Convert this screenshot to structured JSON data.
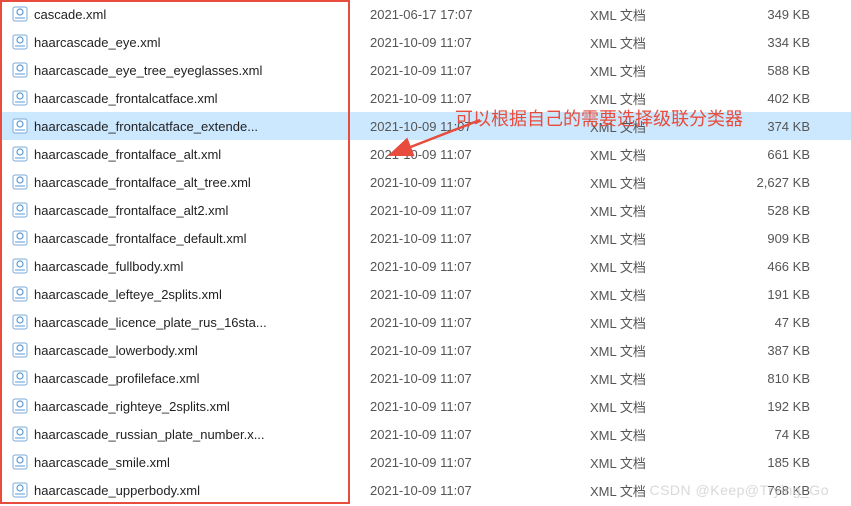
{
  "annotation": "可以根据自己的需要选择级联分类器",
  "watermark": "CSDN @Keep@Trying_Go",
  "files": [
    {
      "name": "cascade.xml",
      "date": "2021-06-17 17:07",
      "type": "XML 文档",
      "size": "349 KB",
      "selected": false
    },
    {
      "name": "haarcascade_eye.xml",
      "date": "2021-10-09 11:07",
      "type": "XML 文档",
      "size": "334 KB",
      "selected": false
    },
    {
      "name": "haarcascade_eye_tree_eyeglasses.xml",
      "date": "2021-10-09 11:07",
      "type": "XML 文档",
      "size": "588 KB",
      "selected": false
    },
    {
      "name": "haarcascade_frontalcatface.xml",
      "date": "2021-10-09 11:07",
      "type": "XML 文档",
      "size": "402 KB",
      "selected": false
    },
    {
      "name": "haarcascade_frontalcatface_extende...",
      "date": "2021-10-09 11:07",
      "type": "XML 文档",
      "size": "374 KB",
      "selected": true
    },
    {
      "name": "haarcascade_frontalface_alt.xml",
      "date": "2021-10-09 11:07",
      "type": "XML 文档",
      "size": "661 KB",
      "selected": false
    },
    {
      "name": "haarcascade_frontalface_alt_tree.xml",
      "date": "2021-10-09 11:07",
      "type": "XML 文档",
      "size": "2,627 KB",
      "selected": false
    },
    {
      "name": "haarcascade_frontalface_alt2.xml",
      "date": "2021-10-09 11:07",
      "type": "XML 文档",
      "size": "528 KB",
      "selected": false
    },
    {
      "name": "haarcascade_frontalface_default.xml",
      "date": "2021-10-09 11:07",
      "type": "XML 文档",
      "size": "909 KB",
      "selected": false
    },
    {
      "name": "haarcascade_fullbody.xml",
      "date": "2021-10-09 11:07",
      "type": "XML 文档",
      "size": "466 KB",
      "selected": false
    },
    {
      "name": "haarcascade_lefteye_2splits.xml",
      "date": "2021-10-09 11:07",
      "type": "XML 文档",
      "size": "191 KB",
      "selected": false
    },
    {
      "name": "haarcascade_licence_plate_rus_16sta...",
      "date": "2021-10-09 11:07",
      "type": "XML 文档",
      "size": "47 KB",
      "selected": false
    },
    {
      "name": "haarcascade_lowerbody.xml",
      "date": "2021-10-09 11:07",
      "type": "XML 文档",
      "size": "387 KB",
      "selected": false
    },
    {
      "name": "haarcascade_profileface.xml",
      "date": "2021-10-09 11:07",
      "type": "XML 文档",
      "size": "810 KB",
      "selected": false
    },
    {
      "name": "haarcascade_righteye_2splits.xml",
      "date": "2021-10-09 11:07",
      "type": "XML 文档",
      "size": "192 KB",
      "selected": false
    },
    {
      "name": "haarcascade_russian_plate_number.x...",
      "date": "2021-10-09 11:07",
      "type": "XML 文档",
      "size": "74 KB",
      "selected": false
    },
    {
      "name": "haarcascade_smile.xml",
      "date": "2021-10-09 11:07",
      "type": "XML 文档",
      "size": "185 KB",
      "selected": false
    },
    {
      "name": "haarcascade_upperbody.xml",
      "date": "2021-10-09 11:07",
      "type": "XML 文档",
      "size": "768 KB",
      "selected": false
    }
  ]
}
